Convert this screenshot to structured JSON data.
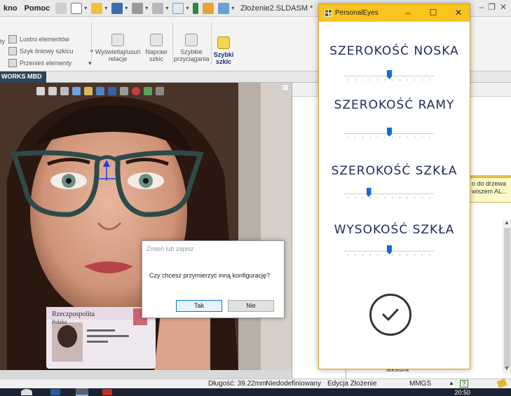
{
  "menubar": {
    "items": [
      "kno",
      "Pomoc"
    ],
    "doc_title": "Złożenie2.SLDASM *",
    "window_controls": [
      "–",
      "❐",
      "✕"
    ]
  },
  "ribbon": {
    "side_label": "ty",
    "rows": [
      "Lustro elementów",
      "Szyk liniowy szkicu",
      "Przenieś elementy"
    ],
    "buttons": [
      {
        "label": "Wyświetlaj/usuń relacje"
      },
      {
        "label": "Napraw szkic"
      },
      {
        "label": "Szybkie przyciągania"
      },
      {
        "label": "Szybki szkic"
      }
    ]
  },
  "tabs": {
    "active": "WORKS MBD"
  },
  "right_panel": {
    "tooltip": "o do drzewa wiszem AL...",
    "list_item": "tekstura"
  },
  "statusbar": {
    "length": "Długość: 39.22mm",
    "state": "Niedodefiniowany",
    "mode": "Edycja Złożenie",
    "units": "MMGS",
    "clock": "20:50"
  },
  "dialog": {
    "title": "Zmień lub zapisz",
    "message": "Czy chcesz przymierzyć inną konfigurację?",
    "yes_label": "Tak",
    "no_label": "Nie"
  },
  "personaleyes": {
    "title": "PersonalEyes",
    "controls": [
      "–",
      "☐",
      "✕"
    ],
    "sliders": [
      {
        "label": "SZEROKOŚĆ NOSKA",
        "value": 0.5
      },
      {
        "label": "SZEROKOŚĆ RAMY",
        "value": 0.5
      },
      {
        "label": "SZEROKOŚĆ SZKŁA",
        "value": 0.27
      },
      {
        "label": "WYSOKOŚĆ SZKŁA",
        "value": 0.5
      }
    ],
    "confirm_icon": "check-icon"
  },
  "id_card": {
    "line1": "Rzeczpospolita",
    "line2": "Polska"
  },
  "colors": {
    "accent": "#f9c41d",
    "label": "#1f2a5c",
    "slider_thumb": "#0f6fd6",
    "glasses_frame": "#2e4a48"
  }
}
